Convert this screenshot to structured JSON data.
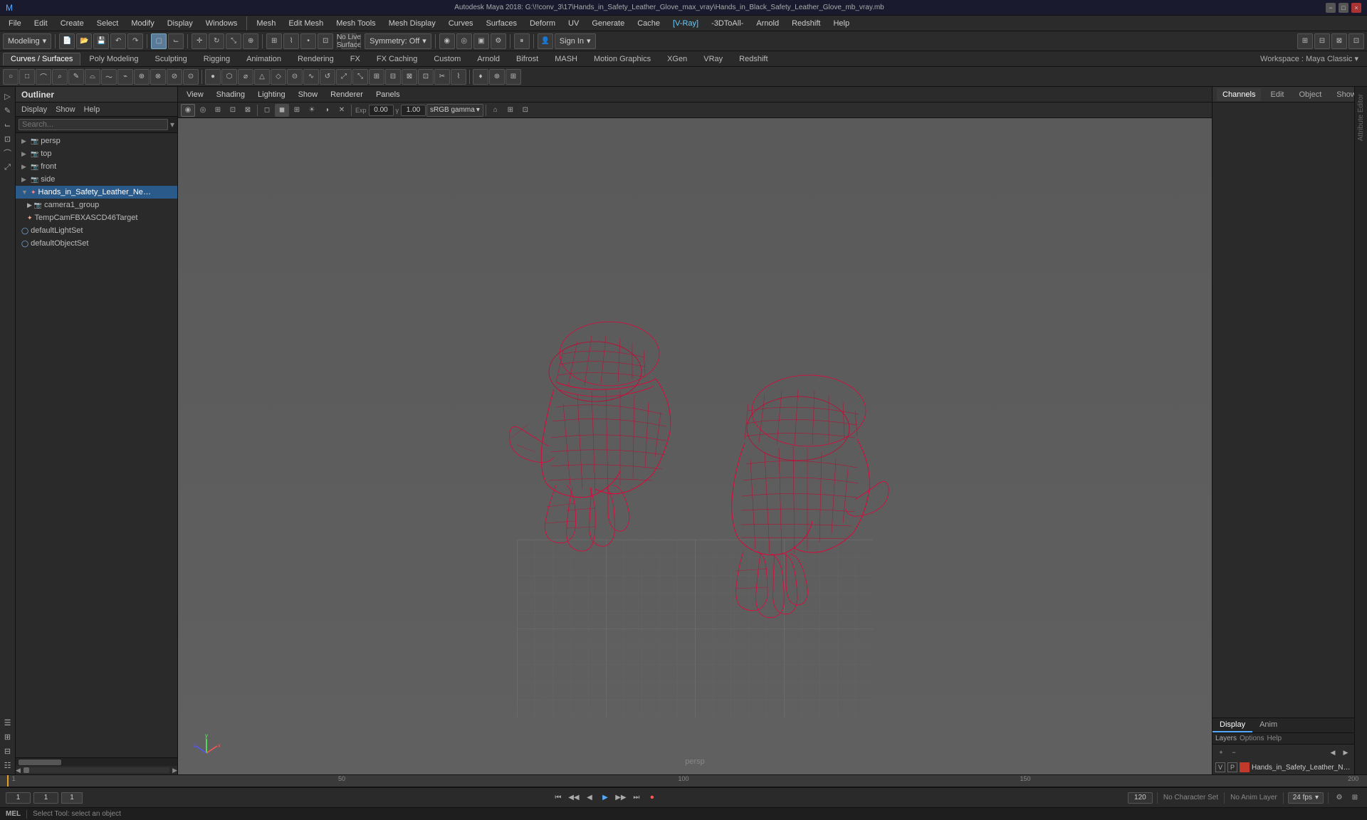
{
  "window": {
    "title": "Autodesk Maya 2018: G:\\!!conv_3\\17\\Hands_in_Safety_Leather_Glove_max_vray\\Hands_in_Black_Safety_Leather_Glove_mb_vray.mb"
  },
  "titlebar": {
    "win_buttons": [
      "−",
      "□",
      "×"
    ]
  },
  "menubar": {
    "items": [
      "File",
      "Edit",
      "Create",
      "Select",
      "Modify",
      "Display",
      "Windows",
      "Mesh",
      "Edit Mesh",
      "Mesh Tools",
      "Mesh Display",
      "Curves",
      "Surfaces",
      "Deform",
      "UV",
      "Generate",
      "Cache",
      "VRay",
      "3DToAll",
      "Arnold",
      "Redshift",
      "Help"
    ]
  },
  "toolbar1": {
    "mode_dropdown": "Modeling",
    "symmetry_label": "Symmetry: Off",
    "no_live_surface": "No Live Surface",
    "sign_in": "Sign In"
  },
  "curves_tabs": {
    "items": [
      "Curves / Surfaces",
      "Poly Modeling",
      "Sculpting",
      "Rigging",
      "Animation",
      "Rendering",
      "FX",
      "FX Caching",
      "Custom",
      "Arnold",
      "Bifrost",
      "MASH",
      "Motion Graphics",
      "XGen",
      "VRay",
      "Redshift"
    ]
  },
  "outliner": {
    "title": "Outliner",
    "menu_items": [
      "Display",
      "Show",
      "Help"
    ],
    "search_placeholder": "Search...",
    "tree_items": [
      {
        "label": "persp",
        "indent": 0,
        "type": "camera",
        "icon": "▶"
      },
      {
        "label": "top",
        "indent": 0,
        "type": "camera",
        "icon": "▶"
      },
      {
        "label": "front",
        "indent": 0,
        "type": "camera",
        "icon": "▶"
      },
      {
        "label": "side",
        "indent": 0,
        "type": "camera",
        "icon": "▶"
      },
      {
        "label": "Hands_in_Safety_Leather_Neoprene_...",
        "indent": 0,
        "type": "mesh",
        "icon": "▼",
        "selected": true
      },
      {
        "label": "camera1_group",
        "indent": 1,
        "type": "group"
      },
      {
        "label": "TempCamFBXASCD46Target",
        "indent": 1,
        "type": "target"
      },
      {
        "label": "defaultLightSet",
        "indent": 0,
        "type": "set"
      },
      {
        "label": "defaultObjectSet",
        "indent": 0,
        "type": "set"
      }
    ]
  },
  "viewport": {
    "menubar": [
      "View",
      "Shading",
      "Lighting",
      "Show",
      "Renderer",
      "Panels"
    ],
    "camera_label": "persp",
    "gamma_label": "sRGB gamma",
    "gamma_value": "1.00",
    "exposure_value": "0.00",
    "vray_label": "[V-Ray]",
    "threedtoall_label": "-3DToAll-"
  },
  "right_panel": {
    "tabs": [
      "Channels",
      "Edit",
      "Object",
      "Show"
    ],
    "sub_tabs": [
      "Display",
      "Anim"
    ],
    "layer_tabs": [
      "Layers",
      "Options",
      "Help"
    ],
    "layer_name": "Hands_in_Safety_Leather_Neo...",
    "layer_v": "V",
    "layer_p": "P"
  },
  "timeline": {
    "start_frame": "1",
    "end_frame": "120",
    "current_frame": "1",
    "range_start": "1",
    "range_end": "120",
    "max_frame": "200",
    "fps_label": "24 fps",
    "no_character_set": "No Character Set",
    "no_anim_layer": "No Anim Layer",
    "tick_labels": [
      "1",
      "50",
      "100",
      "150",
      "200"
    ]
  },
  "transport": {
    "buttons": [
      "⏮",
      "◀◀",
      "◀",
      "▶",
      "▶▶",
      "⏭",
      "⏺"
    ]
  },
  "status_bar": {
    "mode": "MEL",
    "message": "Select Tool: select an object"
  },
  "far_right_strips": [
    "A",
    "t",
    "t",
    "r",
    "i",
    "b",
    "u",
    "t",
    "e",
    "E",
    "d",
    "i",
    "t",
    "o",
    "r"
  ]
}
